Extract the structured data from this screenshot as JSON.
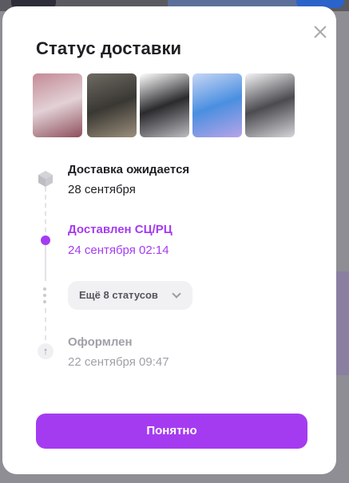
{
  "modal": {
    "title": "Статус доставки",
    "close_icon": "close-icon",
    "accent_color": "#a53bf0"
  },
  "products": [
    {
      "name": "product-thumb-1",
      "colors": [
        "#c48a96",
        "#e2d1d6",
        "#8e4f5c"
      ]
    },
    {
      "name": "product-thumb-2",
      "colors": [
        "#6e6a64",
        "#3a3833",
        "#9c8f7c"
      ]
    },
    {
      "name": "product-thumb-3",
      "colors": [
        "#ffffff",
        "#2b2b2e",
        "#bdbdc2"
      ]
    },
    {
      "name": "product-thumb-4",
      "colors": [
        "#c7d6f5",
        "#4a8fe0",
        "#b8a4e8"
      ]
    },
    {
      "name": "product-thumb-5",
      "colors": [
        "#f4f4f6",
        "#4b4b50",
        "#d6d6da"
      ]
    }
  ],
  "timeline": {
    "expected": {
      "label": "Доставка ожидается",
      "date": "28 сентября",
      "icon": "box-icon"
    },
    "current": {
      "label": "Доставлен СЦ/РЦ",
      "date": "24 сентября 02:14"
    },
    "more_button": {
      "label": "Ещё 8 статусов",
      "icon": "chevron-down-icon"
    },
    "created": {
      "label": "Оформлен",
      "date": "22 сентября 09:47",
      "icon": "arrow-up-icon"
    }
  },
  "confirm_button": {
    "label": "Понятно"
  }
}
